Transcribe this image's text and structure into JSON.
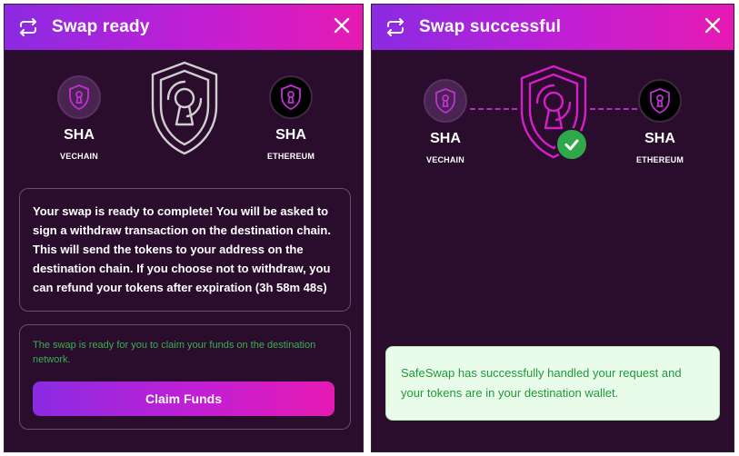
{
  "colors": {
    "panel_bg": "#2a0d2d",
    "header_gradient_start": "#8a2be2",
    "header_gradient_end": "#e61ab2",
    "success_green": "#36b24a",
    "success_box_bg": "#e9fbe9"
  },
  "left_panel": {
    "title": "Swap ready",
    "icons": {
      "header": "swap-arrows-icon",
      "close": "close-icon",
      "center": "shield-keyhole-icon"
    },
    "from_token": {
      "symbol": "SHA",
      "chain": "VECHAIN"
    },
    "to_token": {
      "symbol": "SHA",
      "chain": "ETHEREUM"
    },
    "message": "Your swap is ready to complete! You will be asked to sign a withdraw transaction on the destination chain. This will send the tokens to your address on the destination chain. If you choose not to withdraw, you can refund your tokens after expiration (3h 58m 48s)",
    "claim_note": "The swap is ready for you to claim your funds on the destination network.",
    "claim_button": "Claim Funds"
  },
  "right_panel": {
    "title": "Swap successful",
    "icons": {
      "header": "swap-arrows-icon",
      "close": "close-icon",
      "center": "shield-keyhole-icon",
      "status": "checkmark-icon"
    },
    "from_token": {
      "symbol": "SHA",
      "chain": "VECHAIN"
    },
    "to_token": {
      "symbol": "SHA",
      "chain": "ETHEREUM"
    },
    "success_message": "SafeSwap has successfully handled your request and your tokens are in your destination wallet."
  }
}
